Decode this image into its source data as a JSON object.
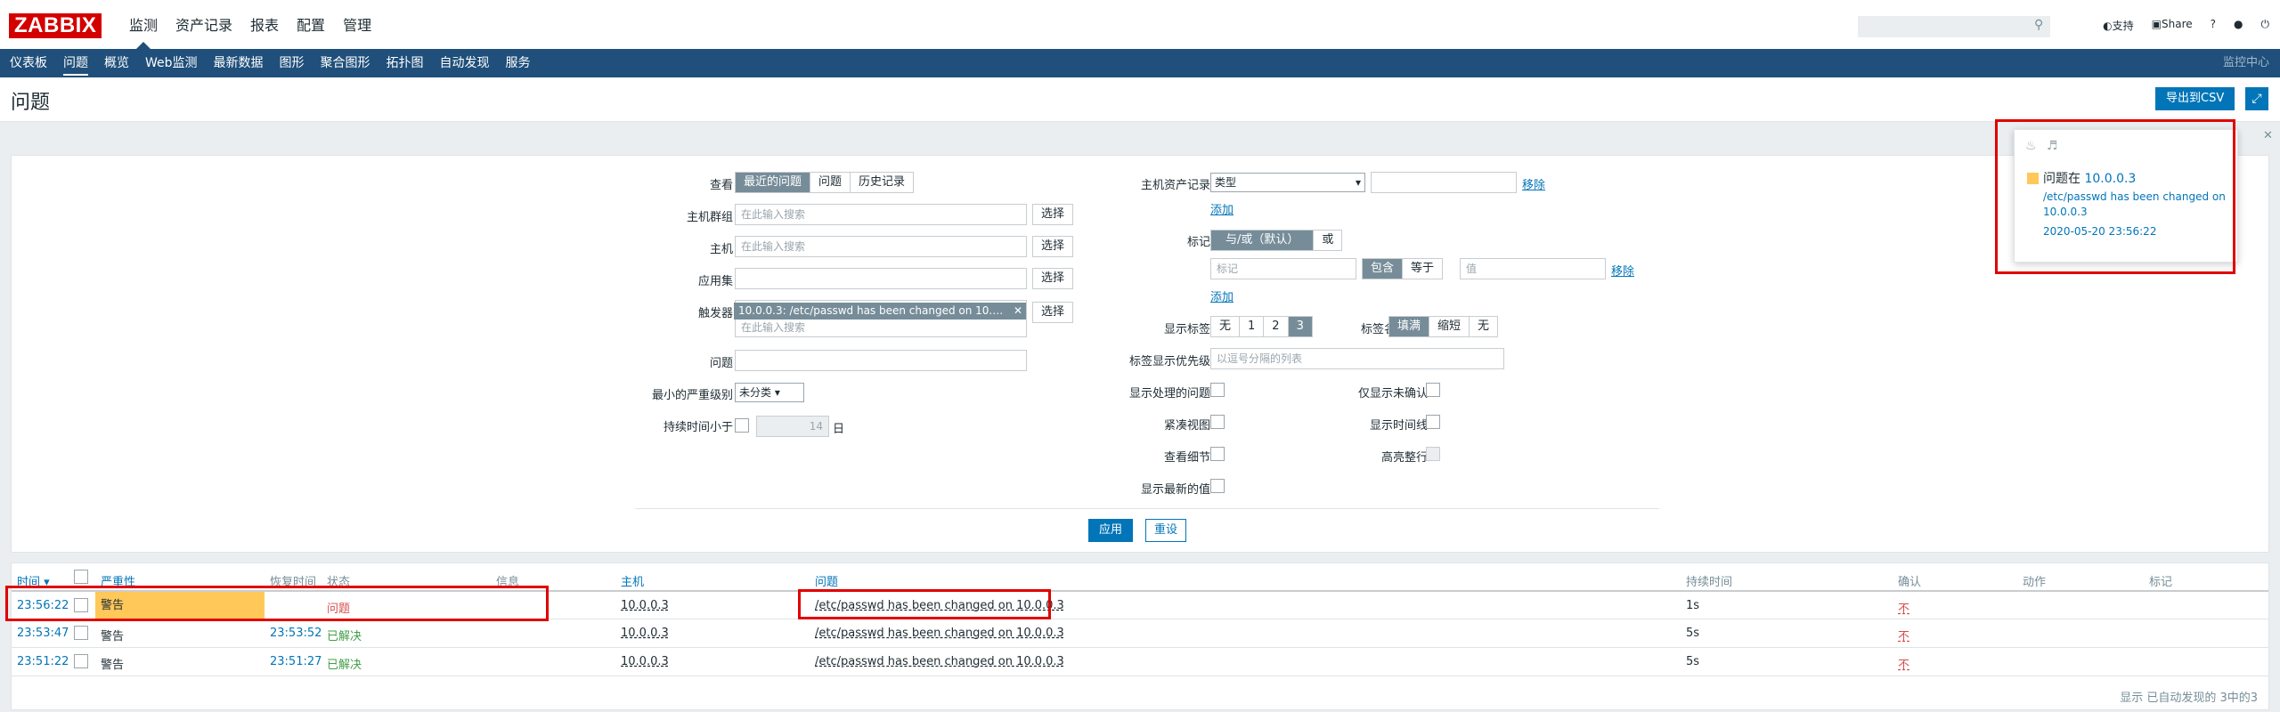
{
  "topbar": {
    "logo": "ZABBIX",
    "menu": [
      "监测",
      "资产记录",
      "报表",
      "配置",
      "管理"
    ],
    "support": "支持",
    "share": "Share",
    "help": "?",
    "search_placeholder": ""
  },
  "subnav": {
    "items": [
      "仪表板",
      "问题",
      "概览",
      "Web监测",
      "最新数据",
      "图形",
      "聚合图形",
      "拓扑图",
      "自动发现",
      "服务"
    ],
    "right": "监控中心"
  },
  "header": {
    "title": "问题",
    "export_label": "导出到CSV"
  },
  "filter": {
    "view_label": "查看",
    "view_options": [
      "最近的问题",
      "问题",
      "历史记录"
    ],
    "host_group_label": "主机群组",
    "host_label": "主机",
    "app_label": "应用集",
    "trigger_label": "触发器",
    "problem_label": "问题",
    "severity_label": "最小的严重级别",
    "severity_value": "未分类",
    "duration_label": "持续时间小于",
    "duration_value": "14",
    "duration_unit": "日",
    "search_placeholder": "在此输入搜索",
    "select_label": "选择",
    "trigger_tag": "10.0.0.3: /etc/passwd has been changed on 10.0.0.3",
    "inventory_label": "主机资产记录",
    "inventory_field": "类型",
    "remove_label": "移除",
    "add_label": "添加",
    "tags_label": "标记",
    "tags_op": [
      "与/或（默认）",
      "或"
    ],
    "tag_placeholder": "标记",
    "tag_match": [
      "包含",
      "等于"
    ],
    "value_placeholder": "值",
    "show_tags_label": "显示标签",
    "show_tags_opts": [
      "无",
      "1",
      "2",
      "3"
    ],
    "tag_name_label": "标签名",
    "tag_name_opts": [
      "填满",
      "缩短",
      "无"
    ],
    "tag_priority_label": "标签显示优先级",
    "tag_priority_placeholder": "以逗号分隔的列表",
    "show_suppressed_label": "显示处理的问题",
    "unack_label": "仅显示未确认",
    "compact_label": "紧凑视图",
    "timeline_label": "显示时间线",
    "details_label": "查看细节",
    "highlight_label": "高亮整行",
    "latest_values_label": "显示最新的值",
    "apply_label": "应用",
    "reset_label": "重设"
  },
  "table": {
    "headers": {
      "time": "时间 ▾",
      "severity": "严重性",
      "recovery": "恢复时间",
      "status": "状态",
      "info": "信息",
      "host": "主机",
      "problem": "问题",
      "duration": "持续时间",
      "ack": "确认",
      "actions": "动作",
      "tags": "标记"
    },
    "rows": [
      {
        "time": "23:56:22",
        "severity": "警告",
        "recovery": "",
        "status": "问题",
        "host": "10.0.0.3",
        "problem": "/etc/passwd has been changed on 10.0.0.3",
        "duration": "1s",
        "ack": "不"
      },
      {
        "time": "23:53:47",
        "severity": "警告",
        "recovery": "23:53:52",
        "status": "已解决",
        "host": "10.0.0.3",
        "problem": "/etc/passwd has been changed on 10.0.0.3",
        "duration": "5s",
        "ack": "不"
      },
      {
        "time": "23:51:22",
        "severity": "警告",
        "recovery": "23:51:27",
        "status": "已解决",
        "host": "10.0.0.3",
        "problem": "/etc/passwd has been changed on 10.0.0.3",
        "duration": "5s",
        "ack": "不"
      }
    ],
    "footer": "显示 已自动发现的 3中的3"
  },
  "popup": {
    "title_prefix": "问题在",
    "host": "10.0.0.3",
    "line1": "/etc/passwd has been changed on",
    "line2": "10.0.0.3",
    "time": "2020-05-20 23:56:22"
  },
  "colors": {
    "brand": "#d40000",
    "nav": "#1f4f7a",
    "accent": "#0275b8",
    "warning": "#ffc859",
    "annotation": "#e00000"
  }
}
